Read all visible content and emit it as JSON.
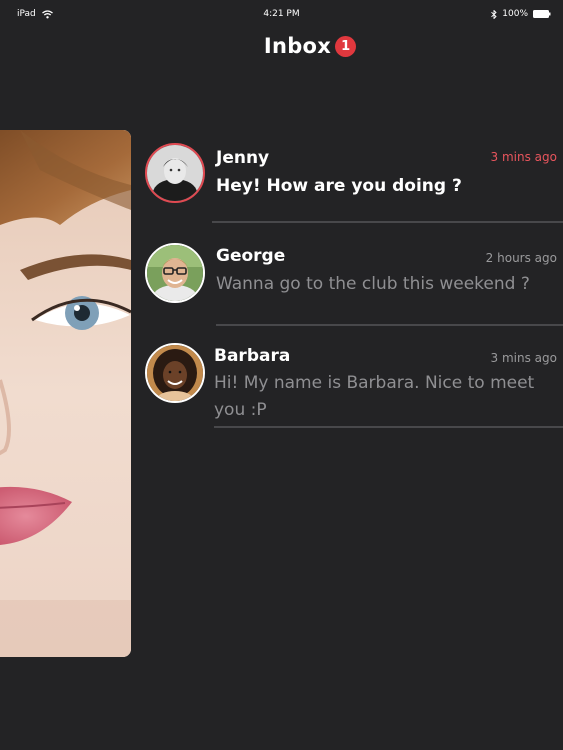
{
  "status_bar": {
    "device": "iPad",
    "time": "4:21 PM",
    "battery": "100%"
  },
  "header": {
    "title": "Inbox",
    "badge_count": "1"
  },
  "messages": [
    {
      "name": "Jenny",
      "time": "3 mins ago",
      "text": "Hey! How are you doing ?",
      "unread": true
    },
    {
      "name": "George",
      "time": "2 hours ago",
      "text": "Wanna go to the club this weekend ?",
      "unread": false
    },
    {
      "name": "Barbara",
      "time": "3 mins ago",
      "text": "Hi! My name is Barbara. Nice to meet you :P",
      "unread": false
    }
  ],
  "colors": {
    "background": "#232325",
    "accent": "#e0383e",
    "muted_text": "#8f8f92"
  }
}
